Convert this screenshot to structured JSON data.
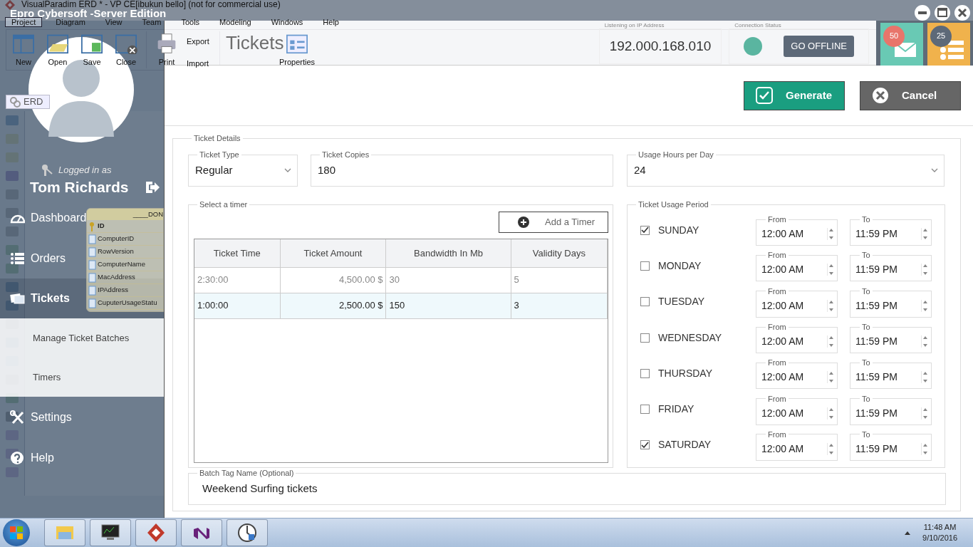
{
  "background_window": {
    "title": "VisualParadim ERD * - VP CE[ibukun bello] (not for commercial use)",
    "menu": [
      {
        "label": "Project",
        "selected": true
      },
      {
        "label": "Diagram",
        "selected": false
      },
      {
        "label": "View",
        "selected": false
      },
      {
        "label": "Team",
        "selected": false
      },
      {
        "label": "Tools",
        "selected": false
      },
      {
        "label": "Modeling",
        "selected": false
      },
      {
        "label": "Windows",
        "selected": false
      },
      {
        "label": "Help",
        "selected": false
      }
    ],
    "ribbon": [
      {
        "label": "New",
        "kind": "large"
      },
      {
        "label": "Open",
        "kind": "large"
      },
      {
        "label": "Save",
        "kind": "large"
      },
      {
        "label": "Close",
        "kind": "large"
      },
      {
        "label": "Print",
        "kind": "large"
      },
      {
        "label": "Export",
        "kind": "small"
      },
      {
        "label": "Import",
        "kind": "small"
      },
      {
        "label": "Properties",
        "kind": "large"
      }
    ],
    "diagram_tab": "ERD",
    "entity": {
      "title": "____DON",
      "fields": [
        "ID",
        "ComputerID",
        "RowVersion",
        "ComputerName",
        "MacAddress",
        "IPAddress",
        "CuputerUsageStatu"
      ]
    }
  },
  "app": {
    "title": "Epro Cybersoft -Server Edition",
    "page_title": "Tickets",
    "ip_label": "Listening on IP Address",
    "ip": "192.000.168.010",
    "connection_label": "Connection Status",
    "offline_button": "GO OFFLINE",
    "notifications": [
      "50",
      "25"
    ]
  },
  "user": {
    "caption": "Logged in as",
    "name": "Tom Richards"
  },
  "nav": [
    {
      "label": "Dashboard",
      "selected": false
    },
    {
      "label": "Orders",
      "selected": false
    },
    {
      "label": "Tickets",
      "selected": true,
      "expanded": true,
      "children": [
        {
          "label": "Manage Ticket Batches",
          "selected": false
        },
        {
          "label": "Timers",
          "selected": false
        }
      ]
    },
    {
      "label": "Settings",
      "selected": false
    },
    {
      "label": "Help",
      "selected": false
    }
  ],
  "actions": {
    "generate": "Generate",
    "cancel": "Cancel"
  },
  "form": {
    "title": "Ticket Details",
    "ticket_type": {
      "label": "Ticket Type",
      "value": "Regular"
    },
    "ticket_copies": {
      "label": "Ticket Copies",
      "value": "180"
    },
    "usage_hours": {
      "label": "Usage Hours per Day",
      "value": "24"
    },
    "timers": {
      "title": "Select a timer",
      "add_button": "Add a Timer",
      "columns": [
        "Ticket Time",
        "Ticket Amount",
        "Bandwidth In Mb",
        "Validity Days"
      ],
      "rows": [
        {
          "cells": [
            "2:30:00",
            "4,500.00 $",
            "30",
            "5"
          ],
          "selected": false
        },
        {
          "cells": [
            "1:00:00",
            "2,500.00 $",
            "150",
            "3"
          ],
          "selected": true
        }
      ]
    },
    "usage_period": {
      "title": "Ticket Usage Period",
      "days": [
        {
          "day": "SUNDAY",
          "checked": true,
          "from_label": "From",
          "from": "12:00 AM",
          "to_label": "To",
          "to": "11:59 PM"
        },
        {
          "day": "MONDAY",
          "checked": false,
          "from_label": "From",
          "from": "12:00 AM",
          "to_label": "To",
          "to": "11:59 PM"
        },
        {
          "day": "TUESDAY",
          "checked": false,
          "from_label": "From",
          "from": "12:00 AM",
          "to_label": "To",
          "to": "11:59 PM"
        },
        {
          "day": "WEDNESDAY",
          "checked": false,
          "from_label": "From",
          "from": "12:00 AM",
          "to_label": "To",
          "to": "11:59 PM"
        },
        {
          "day": "THURSDAY",
          "checked": false,
          "from_label": "From",
          "from": "12:00 AM",
          "to_label": "To",
          "to": "11:59 PM"
        },
        {
          "day": "FRIDAY",
          "checked": false,
          "from_label": "From",
          "from": "12:00 AM",
          "to_label": "To",
          "to": "11:59 PM"
        },
        {
          "day": "SATURDAY",
          "checked": true,
          "from_label": "From",
          "from": "12:00 AM",
          "to_label": "To",
          "to": "11:59 PM"
        }
      ]
    },
    "batch_tag": {
      "label": "Batch Tag Name (Optional)",
      "value": "Weekend Surfing tickets"
    }
  },
  "taskbar": {
    "time": "11:48 AM",
    "date": "9/10/2016"
  }
}
